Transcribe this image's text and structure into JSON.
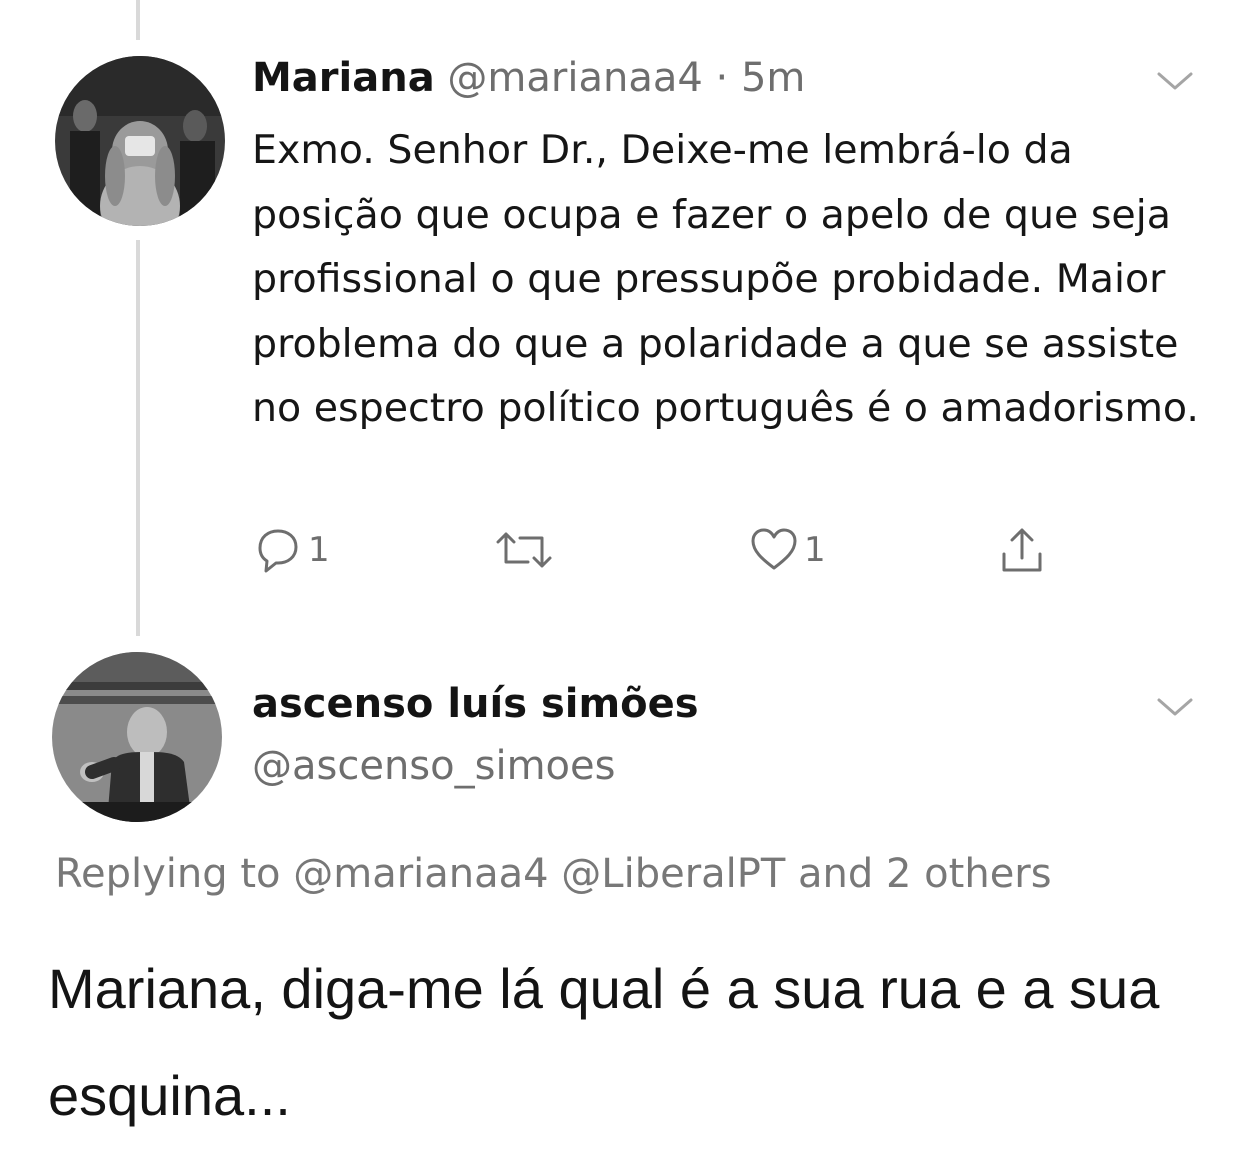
{
  "tweet": {
    "author_name": "Mariana",
    "author_handle": "@marianaa4",
    "separator": "·",
    "time": "5m",
    "text": "Exmo. Senhor Dr., Deixe-me lembrá-lo da posição que ocupa e fazer o apelo de que seja profissional o que pressupõe probidade. Maior problema do que a polaridade a que se assiste no espectro político português é o amadorismo.",
    "reply_count": "1",
    "like_count": "1",
    "icons": {
      "reply": "reply-icon",
      "retweet": "retweet-icon",
      "like": "heart-icon",
      "share": "share-icon",
      "menu": "chevron-down-icon"
    }
  },
  "reply": {
    "author_name": "ascenso luís simões",
    "author_handle": "@ascenso_simoes",
    "replying_to": "Replying to @marianaa4 @LiberalPT and 2 others",
    "text": "Mariana, diga-me lá qual é a sua rua e a sua esquina..."
  },
  "colors": {
    "text": "#141414",
    "secondary": "#6e6e6e",
    "thread_line": "#d9d9d9"
  }
}
